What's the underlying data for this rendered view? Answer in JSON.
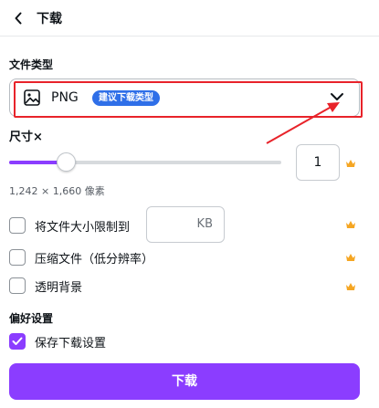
{
  "header": {
    "title": "下载"
  },
  "file_type": {
    "section_label": "文件类型",
    "selected": "PNG",
    "badge": "建议下载类型"
  },
  "size": {
    "label": "尺寸×",
    "scale_value": "1",
    "slider_fraction": 0.2,
    "dimensions": "1,242 × 1,660 像素"
  },
  "options": {
    "limit_size_label": "将文件大小限制到",
    "kb_unit": "KB",
    "compress_label": "压缩文件（低分辨率）",
    "transparent_label": "透明背景"
  },
  "preferences": {
    "section_label": "偏好设置",
    "save_settings_label": "保存下载设置",
    "save_settings_checked": true
  },
  "download_button": {
    "label": "下载"
  },
  "colors": {
    "accent": "#8b3dff",
    "badge": "#2f6fe8",
    "annotation_red": "#e8232a",
    "crown": "#f5a623"
  }
}
